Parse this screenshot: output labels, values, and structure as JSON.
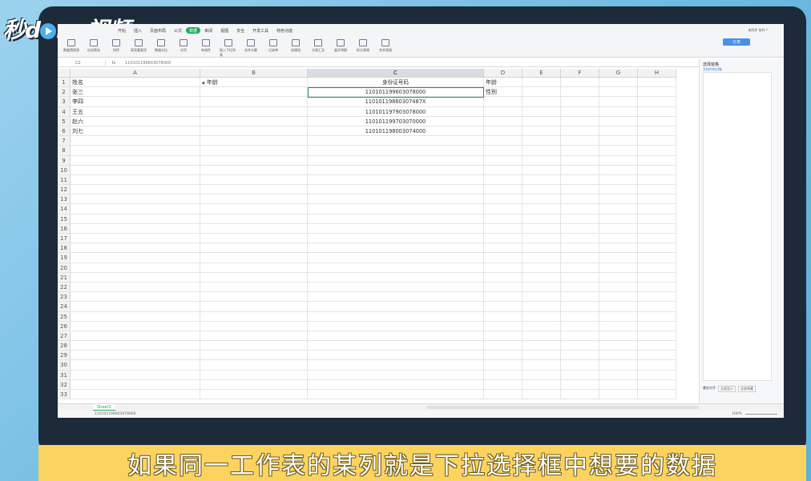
{
  "logo_text": "秒dong视频",
  "caption": "如果同一工作表的某列就是下拉选择框中想要的数据",
  "menu": [
    "开始",
    "插入",
    "页面布局",
    "公式",
    "数据",
    "审阅",
    "视图",
    "安全",
    "开发工具",
    "特色功能"
  ],
  "menu_active_index": 4,
  "ribbon_buttons": [
    "数据透视表",
    "自动筛选",
    "排序",
    "高亮重复项",
    "数据对比",
    "分列",
    "有效性",
    "插入下拉列表",
    "合并计算",
    "记录单",
    "创建组",
    "分类汇总",
    "展开明细",
    "拆分表格",
    "合并表格"
  ],
  "share_label": "分享",
  "top_right": "未同步  协作  ?",
  "formula": {
    "name_box": "C2",
    "fx": "fx",
    "value": "110101199603078000"
  },
  "columns": [
    {
      "label": "",
      "w": 16
    },
    {
      "label": "A",
      "w": 162
    },
    {
      "label": "B",
      "w": 134
    },
    {
      "label": "C",
      "w": 220
    },
    {
      "label": "D",
      "w": 48
    },
    {
      "label": "E",
      "w": 48
    },
    {
      "label": "F",
      "w": 48
    },
    {
      "label": "G",
      "w": 48
    },
    {
      "label": "H",
      "w": 48
    }
  ],
  "selected_column": "C",
  "rows": [
    {
      "n": "1",
      "A": "姓名",
      "B": "年龄",
      "C": "身份证号码",
      "D": "年龄"
    },
    {
      "n": "2",
      "A": "张三",
      "B": "",
      "C": "110101199603078000",
      "D": "性别"
    },
    {
      "n": "3",
      "A": "李四",
      "B": "",
      "C": "11010119860307487X",
      "D": ""
    },
    {
      "n": "4",
      "A": "王五",
      "B": "",
      "C": "110101197903078000",
      "D": ""
    },
    {
      "n": "5",
      "A": "赵六",
      "B": "",
      "C": "110101199703070000",
      "D": ""
    },
    {
      "n": "6",
      "A": "刘七",
      "B": "",
      "C": "110101198003074000",
      "D": ""
    },
    {
      "n": "7"
    },
    {
      "n": "8"
    },
    {
      "n": "9"
    },
    {
      "n": "10"
    },
    {
      "n": "11"
    },
    {
      "n": "12"
    },
    {
      "n": "13"
    },
    {
      "n": "14"
    },
    {
      "n": "15"
    },
    {
      "n": "16"
    },
    {
      "n": "17"
    },
    {
      "n": "18"
    },
    {
      "n": "19"
    },
    {
      "n": "20"
    },
    {
      "n": "21"
    },
    {
      "n": "22"
    },
    {
      "n": "23"
    },
    {
      "n": "24"
    },
    {
      "n": "25"
    },
    {
      "n": "26"
    },
    {
      "n": "27"
    },
    {
      "n": "28"
    },
    {
      "n": "29"
    },
    {
      "n": "30"
    },
    {
      "n": "31"
    },
    {
      "n": "32"
    },
    {
      "n": "33"
    }
  ],
  "right_panel": {
    "title": "选择窗格",
    "link": "文档中的对象",
    "bottom": [
      "全部显示",
      "全部隐藏"
    ],
    "bottom_label": "叠放次序"
  },
  "sheet_tab": "Sheet1",
  "status_left": "110101199603078000",
  "status_right": "100%"
}
